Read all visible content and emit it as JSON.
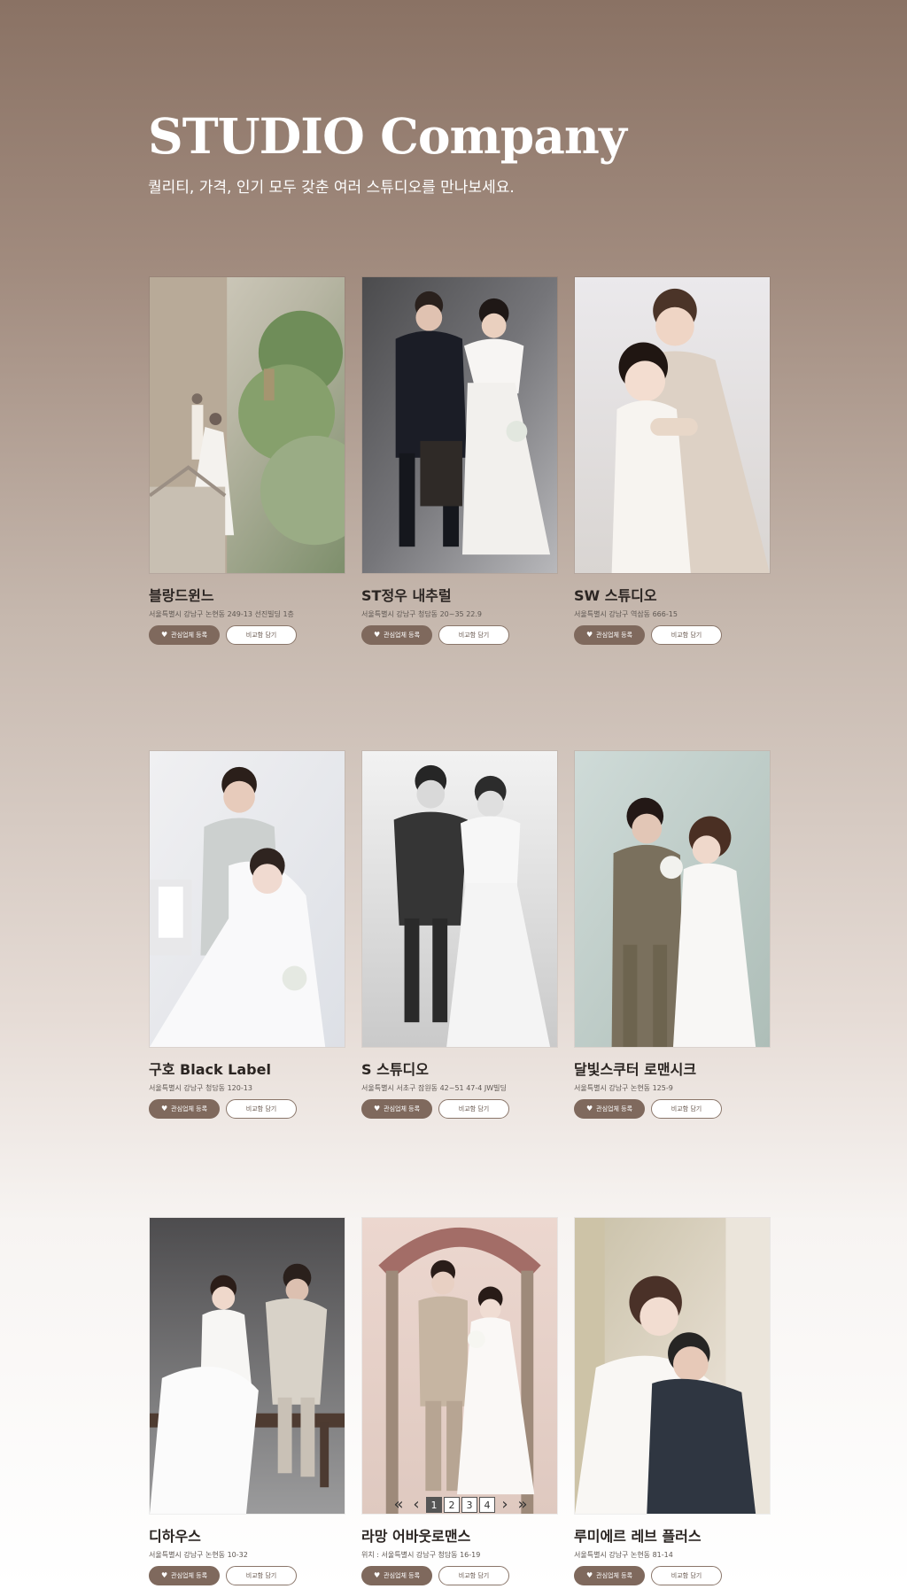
{
  "hero": {
    "title": "STUDIO Company",
    "subtitle": "퀄리티, 가격, 인기 모두 갖춘 여러 스튜디오를 만나보세요."
  },
  "buttons": {
    "favorite_label": "관심업체 등록",
    "compare_label": "비교함 담기"
  },
  "studios": [
    {
      "name": "블랑드윈느",
      "address": "서울특별시 강남구 논현동 249-13 선진빌딩 1층"
    },
    {
      "name": "ST정우 내추럴",
      "address": "서울특별시 강남구 청담동 20~35 22.9"
    },
    {
      "name": "SW 스튜디오",
      "address": "서울특별시 강남구 역삼동 666-15"
    },
    {
      "name": "구호 Black Label",
      "address": "서울특별시 강남구 청담동 120-13"
    },
    {
      "name": "S 스튜디오",
      "address": "서울특별시 서초구 잠원동 42~51 47-4 JW빌딩"
    },
    {
      "name": "달빛스쿠터 로맨시크",
      "address": "서울특별시 강남구 논현동 125-9"
    },
    {
      "name": "디하우스",
      "address": "서울특별시 강남구 논현동 10-32"
    },
    {
      "name": "라망 어바웃로맨스",
      "address": "위치 : 서울특별시 강남구 청담동 16-19"
    },
    {
      "name": "루미에르 레브 플러스",
      "address": "서울특별시 강남구 논현동 81-14"
    }
  ],
  "pagination": {
    "first_label": "«",
    "prev_label": "‹",
    "pages": [
      "1",
      "2",
      "3",
      "4"
    ],
    "next_label": "›",
    "last_label": "»"
  }
}
